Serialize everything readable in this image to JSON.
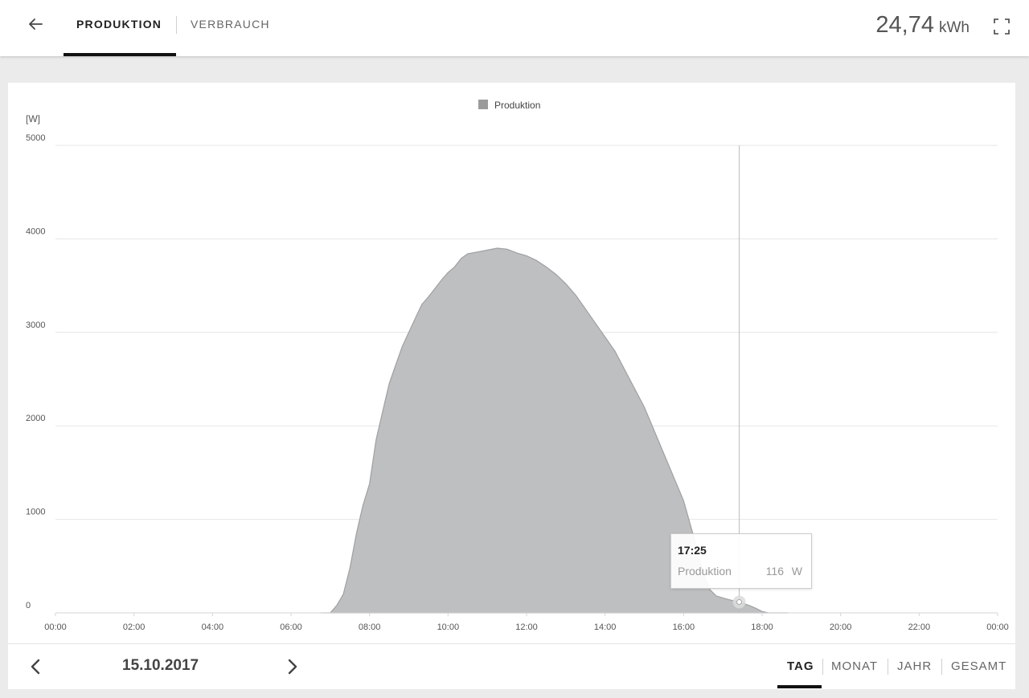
{
  "header": {
    "tabs": [
      {
        "label": "PRODUKTION",
        "active": true
      },
      {
        "label": "VERBRAUCH",
        "active": false
      }
    ],
    "total_value": "24,74",
    "total_unit": "kWh",
    "icons": {
      "back": "arrow-left-icon",
      "fullscreen": "fullscreen-icon"
    }
  },
  "chart": {
    "legend_label": "Produktion",
    "unit_label": "[W]",
    "y_ticks": [
      "5000",
      "4000",
      "3000",
      "2000",
      "1000",
      "0"
    ],
    "x_ticks": [
      "00:00",
      "02:00",
      "04:00",
      "06:00",
      "08:00",
      "10:00",
      "12:00",
      "14:00",
      "16:00",
      "18:00",
      "20:00",
      "22:00",
      "00:00"
    ],
    "tooltip": {
      "time": "17:25",
      "series": "Produktion",
      "value": "116",
      "unit": "W"
    }
  },
  "chart_data": {
    "type": "area",
    "title": "",
    "xlabel": "",
    "ylabel": "[W]",
    "ylim": [
      0,
      5000
    ],
    "xlim": [
      "00:00",
      "24:00"
    ],
    "grid": true,
    "legend": "top-center",
    "area_color": "#9b9b9b",
    "series": [
      {
        "name": "Produktion",
        "points": [
          [
            "06:45",
            0
          ],
          [
            "07:00",
            0
          ],
          [
            "07:10",
            80
          ],
          [
            "07:20",
            200
          ],
          [
            "07:30",
            480
          ],
          [
            "07:40",
            850
          ],
          [
            "07:50",
            1150
          ],
          [
            "08:00",
            1380
          ],
          [
            "08:10",
            1850
          ],
          [
            "08:20",
            2150
          ],
          [
            "08:30",
            2450
          ],
          [
            "08:40",
            2650
          ],
          [
            "08:50",
            2850
          ],
          [
            "09:00",
            3000
          ],
          [
            "09:10",
            3150
          ],
          [
            "09:20",
            3300
          ],
          [
            "09:30",
            3380
          ],
          [
            "09:40",
            3470
          ],
          [
            "09:50",
            3560
          ],
          [
            "10:00",
            3640
          ],
          [
            "10:10",
            3700
          ],
          [
            "10:20",
            3790
          ],
          [
            "10:30",
            3840
          ],
          [
            "10:45",
            3860
          ],
          [
            "11:00",
            3880
          ],
          [
            "11:15",
            3900
          ],
          [
            "11:30",
            3890
          ],
          [
            "11:45",
            3850
          ],
          [
            "12:00",
            3820
          ],
          [
            "12:15",
            3770
          ],
          [
            "12:30",
            3700
          ],
          [
            "12:45",
            3620
          ],
          [
            "13:00",
            3520
          ],
          [
            "13:15",
            3400
          ],
          [
            "13:30",
            3250
          ],
          [
            "13:45",
            3100
          ],
          [
            "14:00",
            2950
          ],
          [
            "14:15",
            2800
          ],
          [
            "14:30",
            2600
          ],
          [
            "14:45",
            2400
          ],
          [
            "15:00",
            2200
          ],
          [
            "15:15",
            1950
          ],
          [
            "15:30",
            1700
          ],
          [
            "15:45",
            1450
          ],
          [
            "16:00",
            1200
          ],
          [
            "16:10",
            950
          ],
          [
            "16:20",
            700
          ],
          [
            "16:30",
            420
          ],
          [
            "16:40",
            250
          ],
          [
            "16:50",
            180
          ],
          [
            "17:00",
            160
          ],
          [
            "17:10",
            140
          ],
          [
            "17:25",
            116
          ],
          [
            "17:40",
            80
          ],
          [
            "17:50",
            50
          ],
          [
            "18:00",
            15
          ],
          [
            "18:10",
            0
          ],
          [
            "18:40",
            0
          ]
        ]
      }
    ],
    "marker": {
      "x": "17:25",
      "y": 116
    }
  },
  "footer": {
    "date": "15.10.2017",
    "periods": [
      {
        "label": "TAG",
        "active": true
      },
      {
        "label": "MONAT",
        "active": false
      },
      {
        "label": "JAHR",
        "active": false
      },
      {
        "label": "GESAMT",
        "active": false
      }
    ],
    "icons": {
      "prev": "chevron-left-icon",
      "next": "chevron-right-icon"
    }
  }
}
